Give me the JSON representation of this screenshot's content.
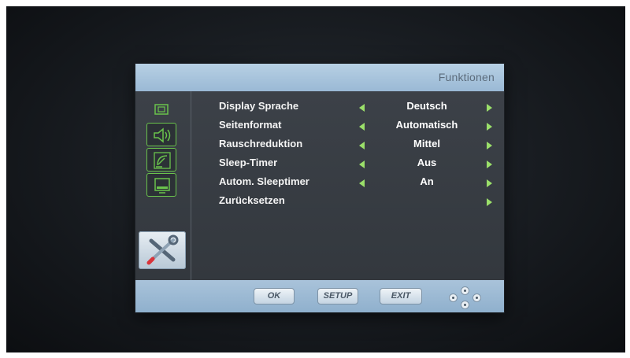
{
  "panel": {
    "title": "Funktionen"
  },
  "sidebar": {
    "icons": [
      "picture-icon",
      "speaker-icon",
      "satellite-icon",
      "monitor-icon",
      "tools-icon"
    ],
    "selected": "tools-icon"
  },
  "menu": {
    "items": [
      {
        "label": "Display Sprache",
        "value": "Deutsch"
      },
      {
        "label": "Seitenformat",
        "value": "Automatisch"
      },
      {
        "label": "Rauschreduktion",
        "value": "Mittel"
      },
      {
        "label": "Sleep-Timer",
        "value": "Aus"
      },
      {
        "label": "Autom. Sleeptimer",
        "value": "An"
      },
      {
        "label": "Zurücksetzen",
        "value": ""
      }
    ]
  },
  "footer": {
    "ok": "OK",
    "setup": "SETUP",
    "exit": "EXIT"
  },
  "colors": {
    "accent_green": "#9be06a",
    "header_blue": "#a9c3da",
    "panel_bg": "#3b4047"
  }
}
